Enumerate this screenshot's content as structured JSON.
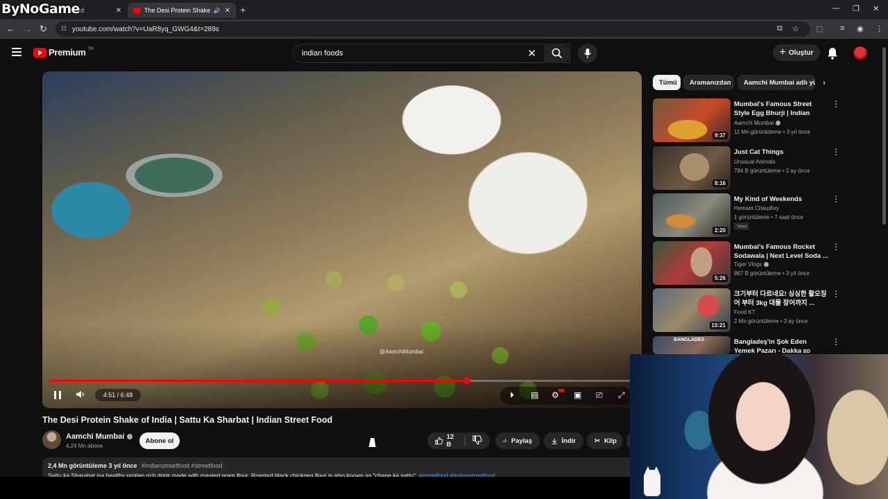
{
  "overlay": {
    "brand": "ByNoGame"
  },
  "browser": {
    "tabs": [
      {
        "title": "board"
      },
      {
        "title": "The Desi Protein Shake of I"
      }
    ],
    "url": "youtube.com/watch?v=UaR8yq_GWG4&t=289s"
  },
  "header": {
    "logo_text": "Premium",
    "region": "TR",
    "search_value": "indian foods",
    "create_label": "Oluştur"
  },
  "player": {
    "watermark": "@AamchiMumbai",
    "current_time": "4:51",
    "duration": "6:48",
    "progress": 0.713,
    "time_display": "4:51 / 6:48"
  },
  "video": {
    "title": "The Desi Protein Shake of India | Sattu Ka Sharbat | Indian Street Food",
    "channel": "Aamchi Mumbai",
    "subscribers": "4,24 Mn abone",
    "subscribe_label": "Abone ol",
    "likes": "12 B",
    "share_label": "Paylaş",
    "download_label": "İndir",
    "clip_label": "Klip",
    "views_date": "2,4 Mn görüntüleme  3 yıl önce",
    "tags": "#indianstreetfood #streetfood",
    "description": "Sattu ka Sharabat isa healthy protien rich drink made with roasted gram flour. Roasted black chickpea flour is also known as \"chane ka sattu\".",
    "description_tags": "#streetfood #indianstreetfood"
  },
  "sidebar": {
    "chips": [
      "Tümü",
      "Aramanızdan",
      "Aamchi Mumbai adlı yükleyiciden"
    ],
    "recommendations": [
      {
        "title": "Mumbai's Famous Street Style Egg Bhurji | Indian Street Food",
        "channel": "Aamchi Mumbai",
        "verified": true,
        "meta": "11 Mn görüntüleme • 3 yıl önce",
        "duration": "9:37",
        "badge": ""
      },
      {
        "title": "Just Cat Things",
        "channel": "Unusual Animals",
        "verified": false,
        "meta": "784 B görüntüleme • 2 ay önce",
        "duration": "8:16",
        "badge": ""
      },
      {
        "title": "My Kind of Weekends",
        "channel": "Hemant Chaudhry",
        "verified": false,
        "meta": "1 görüntüleme • 7 saat önce",
        "duration": "2:20",
        "badge": "Yeni"
      },
      {
        "title": "Mumbai's Famous Rocket Sodawala | Next Level Soda ...",
        "channel": "Tiger Vlogs",
        "verified": true,
        "meta": "867 B görüntüleme • 3 yıl önce",
        "duration": "5:26",
        "badge": ""
      },
      {
        "title": "크기부터 다르네요! 싱싱한 활오징어 부터 3kg 대물 장어까지 ...",
        "channel": "Food KT",
        "verified": false,
        "meta": "2 Mn görüntüleme • 3 ay önce",
        "duration": "15:21",
        "badge": ""
      },
      {
        "title": "Bangladeş'in Şok Eden Yemek Pazarı - Dakka",
        "channel": "",
        "verified": false,
        "meta": "",
        "duration": "",
        "badge": ""
      }
    ],
    "rec_last_suffix": "BD",
    "rec_last_thumb_label": "BANGLADES"
  }
}
